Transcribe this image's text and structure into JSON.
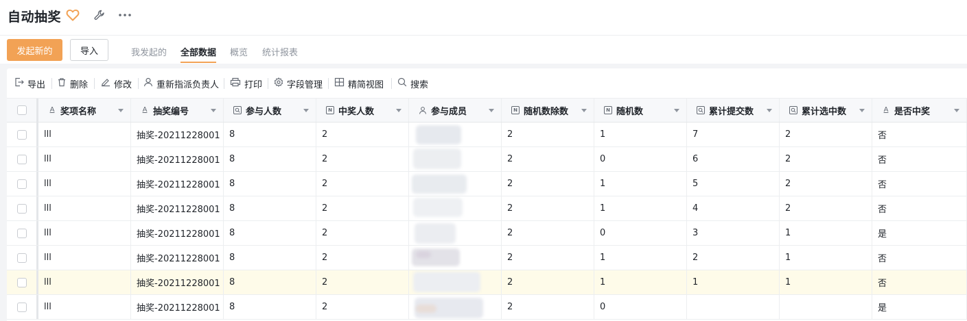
{
  "app": {
    "title": "自动抽奖",
    "favorite_icon": "heart-icon",
    "settings_icon": "wrench-icon",
    "more_icon": "more-horizontal-icon"
  },
  "actions": {
    "primary_label": "发起新的",
    "import_label": "导入"
  },
  "tabs": [
    {
      "label": "我发起的",
      "active": false
    },
    {
      "label": "全部数据",
      "active": true
    },
    {
      "label": "概览",
      "active": false
    },
    {
      "label": "统计报表",
      "active": false
    }
  ],
  "toolbar": {
    "export": "导出",
    "delete": "删除",
    "edit": "修改",
    "reassign": "重新指派负责人",
    "print": "打印",
    "fields": "字段管理",
    "compact": "精简视图",
    "search": "搜索"
  },
  "columns": [
    {
      "label": "奖项名称",
      "type": "text"
    },
    {
      "label": "抽奖编号",
      "type": "text"
    },
    {
      "label": "参与人数",
      "type": "query"
    },
    {
      "label": "中奖人数",
      "type": "number"
    },
    {
      "label": "参与成员",
      "type": "member"
    },
    {
      "label": "随机数除数",
      "type": "number"
    },
    {
      "label": "随机数",
      "type": "number"
    },
    {
      "label": "累计提交数",
      "type": "query"
    },
    {
      "label": "累计选中数",
      "type": "query"
    },
    {
      "label": "是否中奖",
      "type": "text"
    }
  ],
  "rows": [
    {
      "name": "lll",
      "code": "抽奖-20211228001",
      "participants": "8",
      "winners": "2",
      "divisor": "2",
      "random": "1",
      "submitted": "7",
      "selected": "2",
      "won": "否"
    },
    {
      "name": "lll",
      "code": "抽奖-20211228001",
      "participants": "8",
      "winners": "2",
      "divisor": "2",
      "random": "0",
      "submitted": "6",
      "selected": "2",
      "won": "否"
    },
    {
      "name": "lll",
      "code": "抽奖-20211228001",
      "participants": "8",
      "winners": "2",
      "divisor": "2",
      "random": "1",
      "submitted": "5",
      "selected": "2",
      "won": "否"
    },
    {
      "name": "lll",
      "code": "抽奖-20211228001",
      "participants": "8",
      "winners": "2",
      "divisor": "2",
      "random": "1",
      "submitted": "4",
      "selected": "2",
      "won": "否"
    },
    {
      "name": "lll",
      "code": "抽奖-20211228001",
      "participants": "8",
      "winners": "2",
      "divisor": "2",
      "random": "0",
      "submitted": "3",
      "selected": "1",
      "won": "是"
    },
    {
      "name": "lll",
      "code": "抽奖-20211228001",
      "participants": "8",
      "winners": "2",
      "divisor": "2",
      "random": "1",
      "submitted": "2",
      "selected": "1",
      "won": "否"
    },
    {
      "name": "lll",
      "code": "抽奖-20211228001",
      "participants": "8",
      "winners": "2",
      "divisor": "2",
      "random": "1",
      "submitted": "1",
      "selected": "1",
      "won": "否"
    },
    {
      "name": "lll",
      "code": "抽奖-20211228001",
      "participants": "8",
      "winners": "2",
      "divisor": "2",
      "random": "0",
      "submitted": "",
      "selected": "",
      "won": "是"
    }
  ],
  "highlight_row_index": 6,
  "colors": {
    "accent": "#f2a255",
    "highlight_row": "#fefbe9"
  }
}
